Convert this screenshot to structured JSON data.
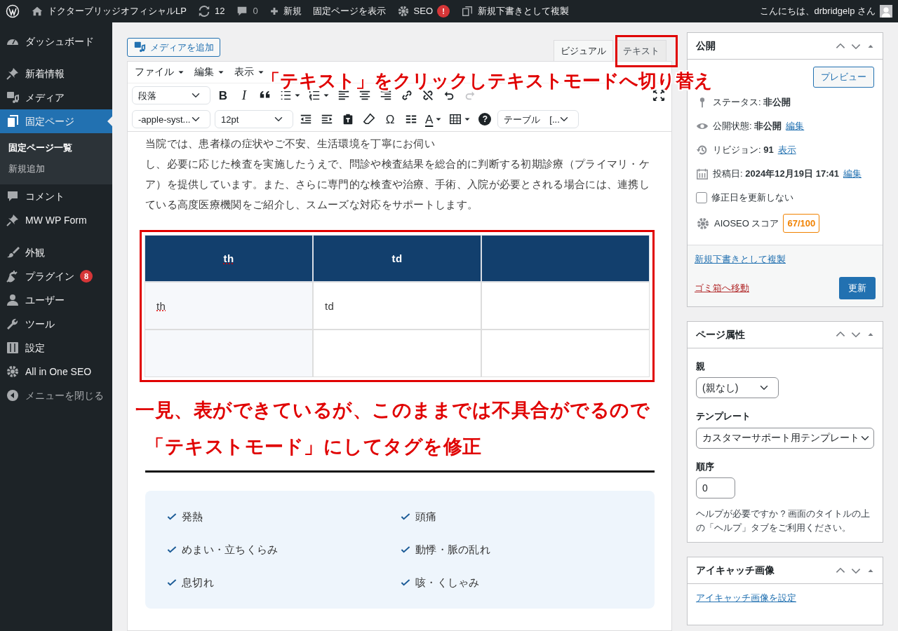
{
  "admin_bar": {
    "items": [
      {
        "kind": "logo"
      },
      {
        "kind": "home",
        "label": "ドクターブリッジオフィシャルLP"
      },
      {
        "kind": "updates",
        "label": "12"
      },
      {
        "kind": "comments",
        "label": "0"
      },
      {
        "kind": "new",
        "label": "新規"
      },
      {
        "kind": "text",
        "label": "固定ページを表示"
      },
      {
        "kind": "seo",
        "label": "SEO",
        "badge": "!"
      },
      {
        "kind": "copy",
        "label": "新規下書きとして複製"
      }
    ],
    "greeting": "こんにちは、drbridgelp さん"
  },
  "sidebar": {
    "groups": [
      {
        "items": [
          {
            "kind": "dashboard",
            "label": "ダッシュボード",
            "selected": false
          }
        ]
      },
      {
        "items": [
          {
            "kind": "pin",
            "label": "新着情報",
            "selected": false
          },
          {
            "kind": "media",
            "label": "メディア",
            "selected": false
          },
          {
            "kind": "pages",
            "label": "固定ページ",
            "selected": true,
            "children": [
              {
                "label": "固定ページ一覧",
                "selected": true
              },
              {
                "label": "新規追加",
                "selected": false
              }
            ]
          },
          {
            "kind": "comment",
            "label": "コメント",
            "selected": false
          },
          {
            "kind": "pin",
            "label": "MW WP Form",
            "selected": false
          }
        ]
      },
      {
        "items": [
          {
            "kind": "appearance",
            "label": "外観",
            "selected": false
          },
          {
            "kind": "plugin",
            "label": "プラグイン",
            "selected": false,
            "badge": "8"
          },
          {
            "kind": "user",
            "label": "ユーザー",
            "selected": false
          },
          {
            "kind": "tool",
            "label": "ツール",
            "selected": false
          },
          {
            "kind": "settings",
            "label": "設定",
            "selected": false
          },
          {
            "kind": "seo",
            "label": "All in One SEO",
            "selected": false
          },
          {
            "kind": "collapse",
            "label": "メニューを閉じる",
            "selected": false
          }
        ]
      }
    ]
  },
  "editor": {
    "add_media": "メディアを追加",
    "tabs": [
      {
        "label": "ビジュアル",
        "selected": true
      },
      {
        "label": "テキスト",
        "selected": false
      }
    ],
    "menus": [
      "ファイル",
      "編集",
      "表示"
    ],
    "toolbar": [
      {
        "items": [
          {
            "kind": "select",
            "value": "段落",
            "disabled": false
          },
          {
            "kind": "bold",
            "label": "B",
            "disabled": false
          },
          {
            "kind": "italic",
            "label": "I",
            "disabled": false
          },
          {
            "kind": "quote",
            "disabled": false
          },
          {
            "kind": "bullets",
            "disabled": false
          },
          {
            "kind": "numbers",
            "disabled": false
          },
          {
            "kind": "align-left",
            "disabled": false
          },
          {
            "kind": "align-center",
            "disabled": false
          },
          {
            "kind": "align-right",
            "disabled": false
          },
          {
            "kind": "link",
            "disabled": false
          },
          {
            "kind": "unlink",
            "disabled": false
          },
          {
            "kind": "undo",
            "disabled": false
          },
          {
            "kind": "redo",
            "disabled": true
          },
          {
            "kind": "fullscreen",
            "disabled": false
          }
        ]
      },
      {
        "items": [
          {
            "kind": "select",
            "value": "-apple-syst...",
            "disabled": false
          },
          {
            "kind": "select",
            "value": "12pt",
            "disabled": false
          },
          {
            "kind": "outdent",
            "disabled": false
          },
          {
            "kind": "indent",
            "disabled": false
          },
          {
            "kind": "paste",
            "disabled": false
          },
          {
            "kind": "eraser",
            "disabled": false
          },
          {
            "kind": "omega",
            "label": "Ω",
            "disabled": false
          },
          {
            "kind": "hr",
            "disabled": false
          },
          {
            "kind": "textcolor",
            "label": "A",
            "disabled": false
          },
          {
            "kind": "table",
            "disabled": false
          },
          {
            "kind": "help",
            "label": "?",
            "disabled": false
          },
          {
            "kind": "select",
            "value": "テーブル　[...",
            "disabled": false
          }
        ]
      }
    ],
    "content": {
      "paragraphs": [
        "当院では、患者様の症状やご不安、生活環境を丁寧にお伺い",
        "し、必要に応じた検査を実施したうえで、問診や検査結果を総合的に判断する初期診療（プライマリ・ケア）を提供しています。また、さらに専門的な検査や治療、手術、入院が必要とされる場合には、連携している高度医療機関をご紹介し、スムーズな対応をサポートします。"
      ],
      "table": {
        "header": [
          "th",
          "td"
        ],
        "rows": [
          {
            "kind": "cells",
            "cells": [
              "th",
              "td"
            ]
          },
          {
            "kind": "empty"
          }
        ]
      },
      "checklist": [
        "発熱",
        "頭痛",
        "めまい・立ちくらみ",
        "動悸・脈の乱れ",
        "息切れ",
        "咳・くしゃみ"
      ]
    }
  },
  "annotations": {
    "callout": "「テキスト」をクリックしテキストモードへ切り替え",
    "note_lines": [
      "一見、表ができているが、このままでは不具合がでるので",
      "「テキストモード」にしてタグを修正"
    ]
  },
  "publish": {
    "title": "公開",
    "preview": "プレビュー",
    "rows": [
      {
        "kind": "status",
        "label": "ステータス:",
        "value": "非公開"
      },
      {
        "kind": "visibility",
        "label": "公開状態:",
        "value": "非公開",
        "link": "編集"
      },
      {
        "kind": "revisions",
        "label": "リビジョン:",
        "value": "91",
        "link": "表示"
      },
      {
        "kind": "date",
        "label": "投稿日:",
        "value": "2024年12月19日 17:41",
        "link": "編集"
      }
    ],
    "checkbox": {
      "label": "修正日を更新しない",
      "checked": false
    },
    "score": {
      "label": "AIOSEO スコア",
      "value": "67/100"
    },
    "duplicate": "新規下書きとして複製",
    "trash": "ゴミ箱へ移動",
    "update": "更新"
  },
  "page_attributes": {
    "title": "ページ属性",
    "parent_label": "親",
    "parent": "(親なし)",
    "template_label": "テンプレート",
    "template": "カスタマーサポート用テンプレート",
    "order_label": "順序",
    "order": "0",
    "help": "ヘルプが必要ですか ? 画面のタイトルの上の「ヘルプ」タブをご利用ください。"
  },
  "featured_image": {
    "title": "アイキャッチ画像",
    "link": "アイキャッチ画像を設定"
  }
}
